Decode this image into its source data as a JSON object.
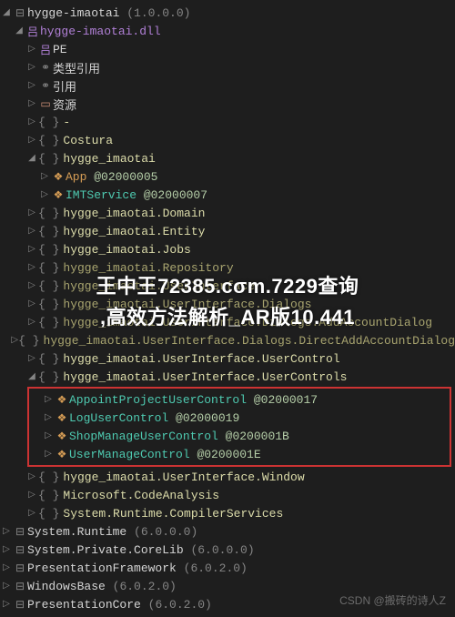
{
  "root": {
    "name": "hygge-imaotai",
    "ver": "(1.0.0.0)"
  },
  "dll": "hygge-imaotai.dll",
  "pe": "PE",
  "typeRefs": "类型引用",
  "refs": "引用",
  "resources": "资源",
  "ns_dash": "-",
  "ns": {
    "costura": "Costura",
    "main": "hygge_imaotai",
    "domain": "hygge_imaotai.Domain",
    "entity": "hygge_imaotai.Entity",
    "jobs": "hygge_imaotai.Jobs",
    "repo": "hygge_imaotai.Repository",
    "ui": "hygge_imaotai.UserInterface",
    "dialogs": "hygge_imaotai.UserInterface.Dialogs",
    "addDlg": "hygge_imaotai.UserInterface.Dialogs.AddAccountDialog",
    "directAdd": "hygge_imaotai.UserInterface.Dialogs.DirectAddAccountDialog",
    "uc1": "hygge_imaotai.UserInterface.UserControl",
    "uc2": "hygge_imaotai.UserInterface.UserControls",
    "window": "hygge_imaotai.UserInterface.Window",
    "msca": "Microsoft.CodeAnalysis",
    "srcs": "System.Runtime.CompilerServices"
  },
  "app": {
    "name": "App",
    "id": "@02000005"
  },
  "imt": {
    "name": "IMTService",
    "id": "@02000007"
  },
  "uc": {
    "appoint": {
      "name": "AppointProjectUserControl",
      "id": "@02000017"
    },
    "log": {
      "name": "LogUserControl",
      "id": "@02000019"
    },
    "shop": {
      "name": "ShopManageUserControl",
      "id": "@0200001B"
    },
    "user": {
      "name": "UserManageControl",
      "id": "@0200001E"
    }
  },
  "asm": {
    "sr": {
      "name": "System.Runtime",
      "ver": "(6.0.0.0)"
    },
    "spcl": {
      "name": "System.Private.CoreLib",
      "ver": "(6.0.0.0)"
    },
    "pf": {
      "name": "PresentationFramework",
      "ver": "(6.0.2.0)"
    },
    "wb": {
      "name": "WindowsBase",
      "ver": "(6.0.2.0)"
    },
    "pc": {
      "name": "PresentationCore",
      "ver": "(6.0.2.0)"
    }
  },
  "overlay": {
    "line1": "王中王72385.cσm.7229查询",
    "line2": ",高效方法解析_AR版10.441"
  },
  "watermark": "CSDN @搬砖的诗人Z",
  "glyph": {
    "collapsed": "▷",
    "expanded": "◢",
    "asmico": "⊟",
    "dll": "吕",
    "pe": "吕",
    "link": "⚭",
    "folder": "▭",
    "class": "❖",
    "pkg": "⊟"
  }
}
